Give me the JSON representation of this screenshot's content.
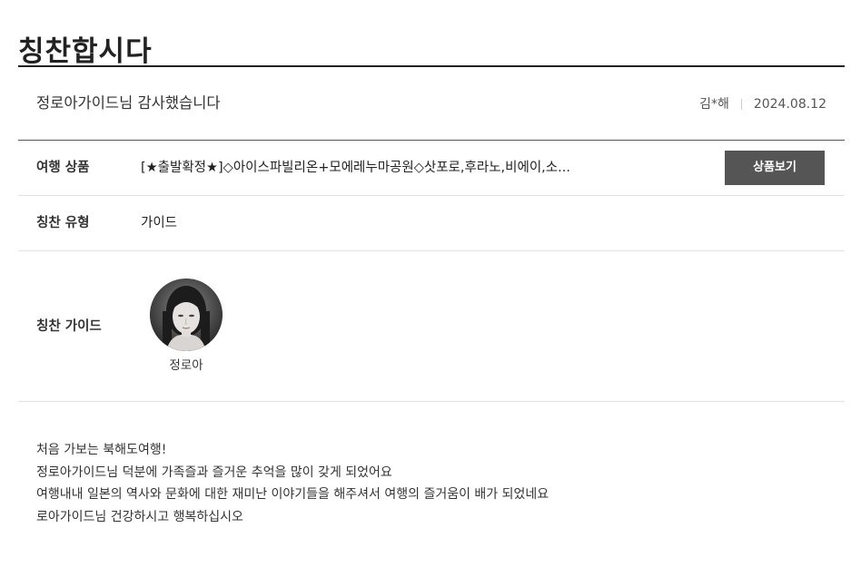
{
  "page": {
    "title": "칭찬합시다"
  },
  "post": {
    "title": "정로아가이드님 감사했습니다",
    "author": "김*해",
    "date": "2024.08.12"
  },
  "details": {
    "product": {
      "label": "여행 상품",
      "value": "[★출발확정★]◇아이스파빌리온+모에레누마공원◇삿포로,후라노,비에이,소...",
      "button_label": "상품보기"
    },
    "praise_type": {
      "label": "칭찬 유형",
      "value": "가이드"
    },
    "guide": {
      "label": "칭찬 가이드",
      "name": "정로아",
      "photo_icon": "guide-portrait-photo"
    }
  },
  "review": {
    "lines": [
      "처음 가보는 북해도여행!",
      "정로아가이드님 덕분에 가족즐과 즐거운 추억을 많이 갖게 되었어요",
      "여행내내 일본의 역사와 문화에 대한 재미난 이야기들을 해주셔서 여행의 즐거움이 배가 되었네요",
      "로아가이드님 건강하시고 행복하십시오"
    ]
  },
  "colors": {
    "text": "#222222",
    "button_bg": "#555555",
    "button_text": "#ffffff",
    "row_divider": "#e2e2e2",
    "title_rule": "#222222"
  }
}
